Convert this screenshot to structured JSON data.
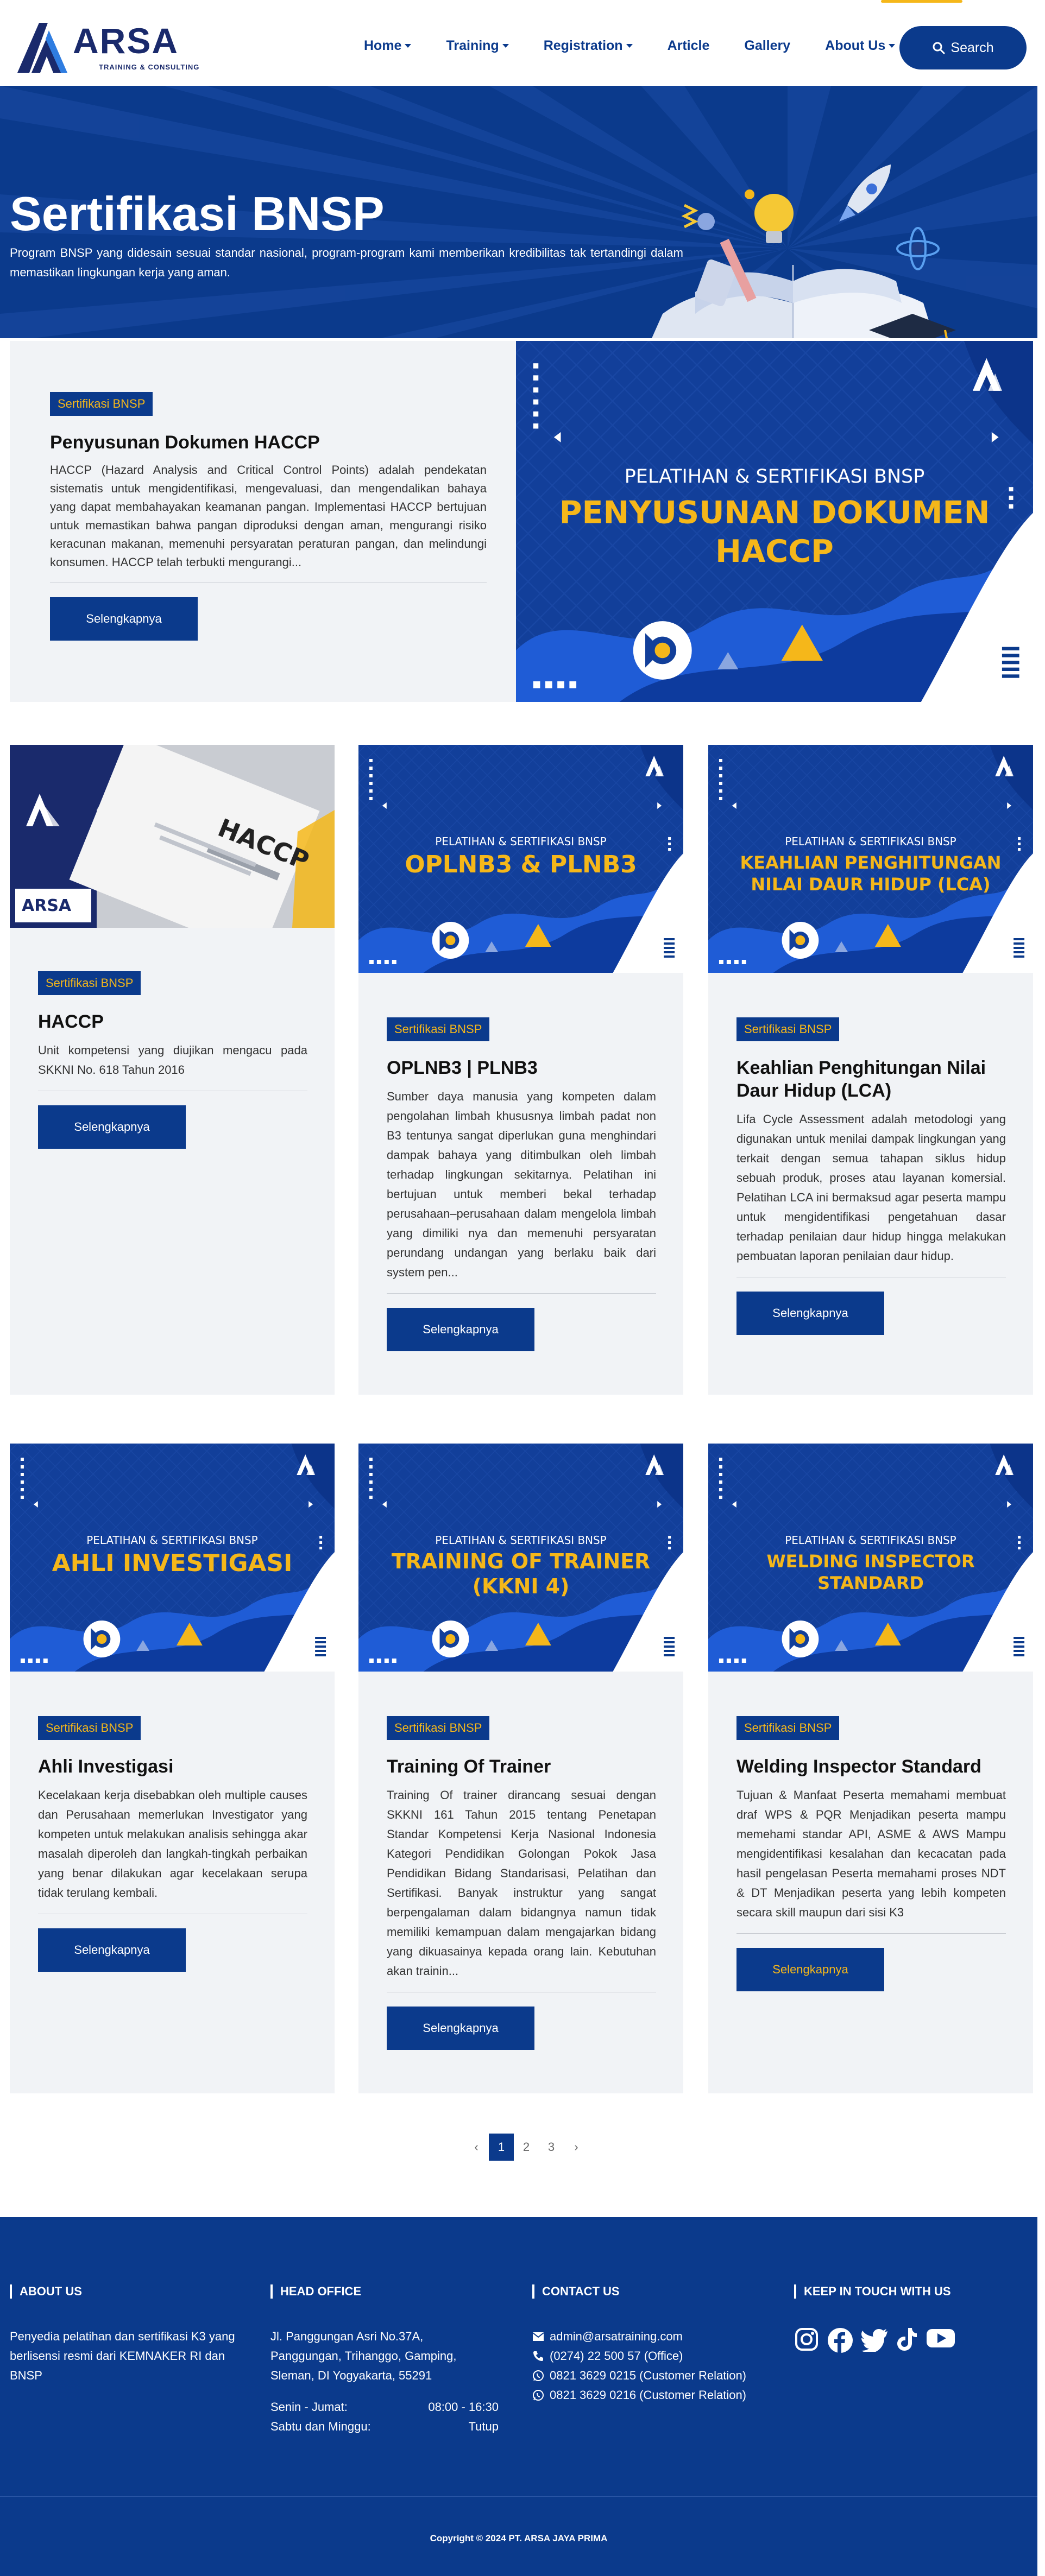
{
  "brand": {
    "name": "ARSA",
    "tagline": "TRAINING & CONSULTING"
  },
  "nav": {
    "items": [
      {
        "label": "Home",
        "dropdown": true
      },
      {
        "label": "Training",
        "dropdown": true
      },
      {
        "label": "Registration",
        "dropdown": true
      },
      {
        "label": "Article",
        "dropdown": false
      },
      {
        "label": "Gallery",
        "dropdown": false
      },
      {
        "label": "About Us",
        "dropdown": true
      }
    ],
    "search_label": "Search"
  },
  "hero": {
    "title": "Sertifikasi BNSP",
    "description": "Program BNSP yang didesain sesuai standar nasional, program-program kami memberikan kredibilitas tak tertandingi dalam memastikan lingkungan kerja yang aman."
  },
  "banner_common": {
    "subtitle": "PELATIHAN & SERTIFIKASI BNSP"
  },
  "featured": {
    "badge": "Sertifikasi BNSP",
    "title": "Penyusunan Dokumen HACCP",
    "description": "HACCP (Hazard Analysis and Critical Control Points) adalah pendekatan sistematis untuk mengidentifikasi, mengevaluasi, dan mengendalikan bahaya yang dapat membahayakan keamanan pangan. Implementasi HACCP bertujuan untuk memastikan bahwa pangan diproduksi dengan aman, mengurangi risiko keracunan makanan, memenuhi persyaratan peraturan pangan, dan melindungi konsumen. HACCP telah terbukti mengurangi...",
    "button": "Selengkapnya",
    "banner_line1": "PENYUSUNAN DOKUMEN",
    "banner_line2": "HACCP"
  },
  "cards": [
    {
      "badge": "Sertifikasi BNSP",
      "title": "HACCP",
      "description": "Unit kompetensi yang diujikan mengacu pada SKKNI No. 618 Tahun 2016",
      "button": "Selengkapnya",
      "image_label": "HACCP",
      "image_brand": "ARSA"
    },
    {
      "badge": "Sertifikasi BNSP",
      "title": "OPLNB3 | PLNB3",
      "description": "Sumber daya manusia yang kompeten dalam pengolahan limbah khususnya limbah padat non B3 tentunya sangat diperlukan guna menghindari dampak bahaya yang ditimbulkan oleh limbah terhadap lingkungan sekitarnya. Pelatihan ini bertujuan untuk memberi bekal terhadap perusahaan–perusahaan dalam mengelola limbah yang dimiliki nya dan memenuhi persyaratan perundang undangan yang berlaku baik dari system pen...",
      "button": "Selengkapnya",
      "banner_line1": "OPLNB3 & PLNB3",
      "banner_line2": ""
    },
    {
      "badge": "Sertifikasi BNSP",
      "title": "Keahlian Penghitungan Nilai Daur Hidup (LCA)",
      "description": "Lifa Cycle Assessment adalah metodologi yang digunakan untuk menilai dampak lingkungan yang terkait dengan semua tahapan siklus hidup sebuah produk, proses atau layanan komersial. Pelatihan LCA ini bermaksud agar peserta mampu untuk mengidentifikasi pengetahuan dasar terhadap penilaian daur hidup hingga melakukan pembuatan laporan penilaian daur hidup.",
      "button": "Selengkapnya",
      "banner_line1": "KEAHLIAN PENGHITUNGAN",
      "banner_line2": "NILAI DAUR HIDUP (LCA)"
    },
    {
      "badge": "Sertifikasi BNSP",
      "title": "Ahli Investigasi",
      "description": "Kecelakaan kerja disebabkan oleh multiple causes dan Perusahaan memerlukan Investigator yang kompeten untuk melakukan analisis sehingga akar masalah diperoleh dan langkah-tingkah perbaikan yang benar dilakukan agar kecelakaan serupa tidak terulang kembali.",
      "button": "Selengkapnya",
      "banner_line1": "AHLI INVESTIGASI",
      "banner_line2": ""
    },
    {
      "badge": "Sertifikasi BNSP",
      "title": "Training Of Trainer",
      "description": "Training Of trainer dirancang sesuai dengan SKKNI 161 Tahun 2015 tentang Penetapan Standar Kompetensi Kerja Nasional Indonesia Kategori Pendidikan Golongan Pokok Jasa Pendidikan Bidang Standarisasi, Pelatihan dan Sertifikasi. Banyak instruktur yang sangat berpengalaman dalam bidangnya namun tidak memiliki kemampuan dalam mengajarkan bidang yang dikuasainya kepada orang lain. Kebutuhan akan trainin...",
      "button": "Selengkapnya",
      "banner_line1": "TRAINING OF TRAINER",
      "banner_line2": "(KKNI 4)"
    },
    {
      "badge": "Sertifikasi BNSP",
      "title": "Welding Inspector Standard",
      "description": "Tujuan & Manfaat Peserta memahami membuat draf WPS & PQR Menjadikan peserta mampu memehami standar API, ASME & AWS Mampu mengidentifikasi kesalahan dan kecacatan pada hasil pengelasan Peserta memahami proses NDT & DT Menjadikan peserta yang lebih kompeten secara skill maupun dari sisi K3",
      "button": "Selengkapnya",
      "banner_line1": "WELDING INSPECTOR",
      "banner_line2": "STANDARD"
    }
  ],
  "pagination": {
    "prev": "‹",
    "pages": [
      "1",
      "2",
      "3"
    ],
    "current": "1",
    "next": "›"
  },
  "footer": {
    "about": {
      "heading": "ABOUT US",
      "text": "Penyedia pelatihan dan sertifikasi K3 yang berlisensi resmi dari KEMNAKER RI dan BNSP"
    },
    "office": {
      "heading": "HEAD OFFICE",
      "address": "Jl. Panggungan Asri No.37A, Panggungan, Trihanggo, Gamping, Sleman, DI Yogyakarta, 55291",
      "hours": [
        {
          "day": "Senin - Jumat:",
          "time": "08:00 - 16:30"
        },
        {
          "day": "Sabtu dan Minggu:",
          "time": "Tutup"
        }
      ]
    },
    "contact": {
      "heading": "CONTACT US",
      "email": "admin@arsatraining.com",
      "phone": "(0274) 22 500 57 (Office)",
      "wa1": "0821 3629 0215 (Customer Relation)",
      "wa2": "0821 3629 0216 (Customer Relation)"
    },
    "social": {
      "heading": "KEEP IN TOUCH WITH US",
      "icons": [
        "instagram-icon",
        "facebook-icon",
        "twitter-icon",
        "tiktok-icon",
        "youtube-icon"
      ]
    },
    "copyright": "Copyright © 2024 PT. ARSA JAYA PRIMA"
  },
  "colors": {
    "primary": "#0b3a8c",
    "accent": "#f5b71a",
    "card_bg": "#f1f3f6"
  }
}
